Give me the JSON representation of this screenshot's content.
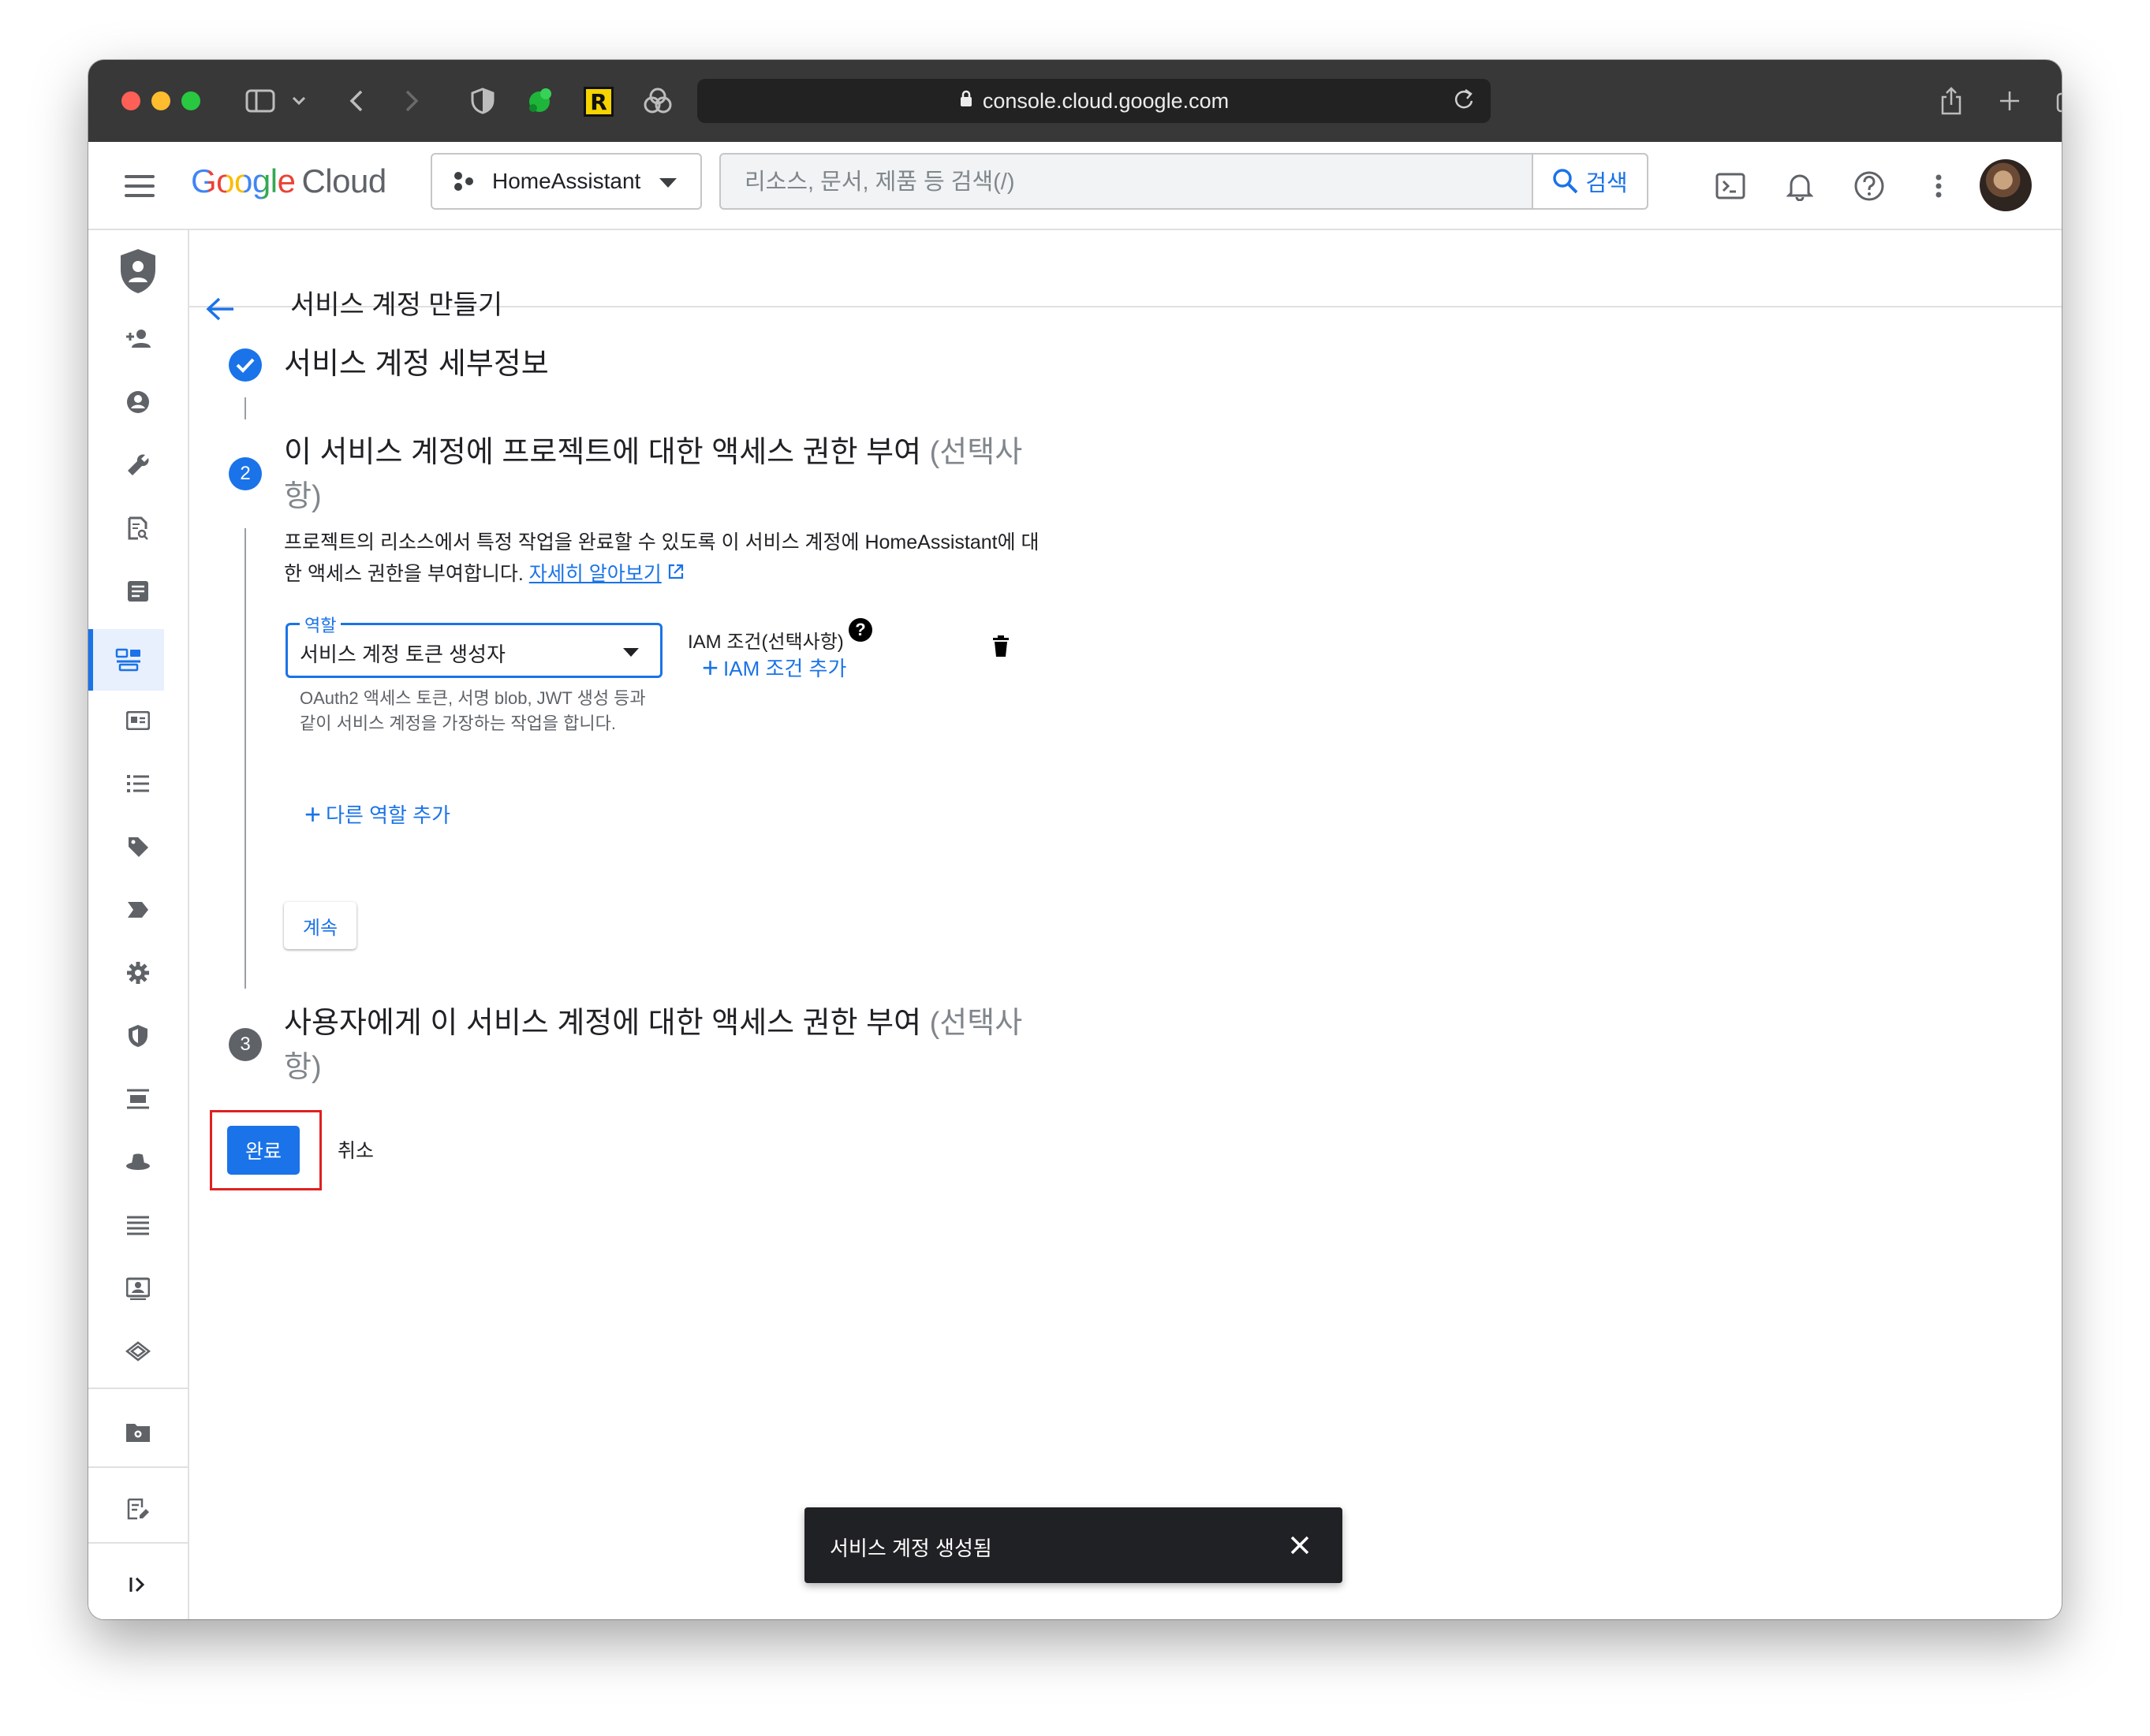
{
  "browser": {
    "url": "console.cloud.google.com",
    "extension_r_label": "R"
  },
  "header": {
    "logo_google": "Google",
    "logo_cloud": "Cloud",
    "project_name": "HomeAssistant",
    "search_placeholder": "리소스, 문서, 제품 등 검색(/)",
    "search_button": "검색"
  },
  "page": {
    "title": "서비스 계정 만들기"
  },
  "steps": {
    "step1": {
      "title": "서비스 계정 세부정보"
    },
    "step2": {
      "number": "2",
      "title": "이 서비스 계정에 프로젝트에 대한 액세스 권한 부여",
      "optional_a": "(선택사",
      "optional_b": "항)",
      "description": "프로젝트의 리소스에서 특정 작업을 완료할 수 있도록 이 서비스 계정에 HomeAssistant에 대한 액세스 권한을 부여합니다.",
      "learn_more": "자세히 알아보기",
      "role_label": "역할",
      "role_value": "서비스 계정 토큰 생성자",
      "role_help": "OAuth2 액세스 토큰, 서명 blob, JWT 생성 등과 같이 서비스 계정을 가장하는 작업을 합니다.",
      "iam_condition_label": "IAM 조건(선택사항)",
      "iam_condition_add": "IAM 조건 추가",
      "add_role": "다른 역할 추가",
      "continue": "계속"
    },
    "step3": {
      "number": "3",
      "title": "사용자에게 이 서비스 계정에 대한 액세스 권한 부여",
      "optional_a": "(선택사",
      "optional_b": "항)"
    }
  },
  "actions": {
    "done": "완료",
    "cancel": "취소"
  },
  "toast": {
    "message": "서비스 계정 생성됨"
  },
  "colors": {
    "accent": "#1a73e8",
    "highlight": "#e02020",
    "toast_bg": "#202124"
  }
}
